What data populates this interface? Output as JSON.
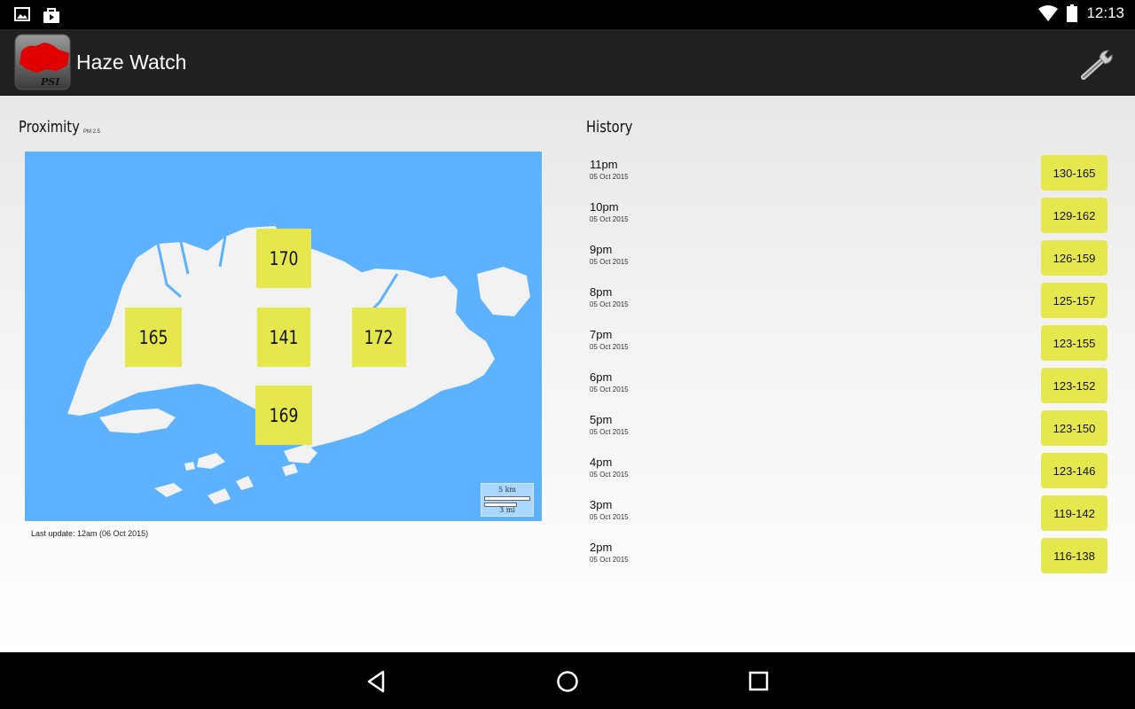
{
  "status_bar": {
    "time": "12:13",
    "left_icons": [
      "image-icon",
      "shopping-bag-icon"
    ],
    "right_icons": [
      "wifi-icon",
      "battery-icon"
    ]
  },
  "action_bar": {
    "title": "Haze Watch",
    "logo_text": "PSI",
    "settings_icon": "wrench-icon"
  },
  "proximity": {
    "title": "Proximity",
    "subtitle": "PM 2.5",
    "readings": {
      "north": "170",
      "west": "165",
      "central": "141",
      "east": "172",
      "south": "169"
    },
    "scale_km": "5 km",
    "scale_mi": "3 mi",
    "last_update": "Last update: 12am (06 Oct 2015)"
  },
  "history": {
    "title": "History",
    "items": [
      {
        "time": "11pm",
        "date": "05 Oct 2015",
        "range": "130-165"
      },
      {
        "time": "10pm",
        "date": "05 Oct 2015",
        "range": "129-162"
      },
      {
        "time": "9pm",
        "date": "05 Oct 2015",
        "range": "126-159"
      },
      {
        "time": "8pm",
        "date": "05 Oct 2015",
        "range": "125-157"
      },
      {
        "time": "7pm",
        "date": "05 Oct 2015",
        "range": "123-155"
      },
      {
        "time": "6pm",
        "date": "05 Oct 2015",
        "range": "123-152"
      },
      {
        "time": "5pm",
        "date": "05 Oct 2015",
        "range": "123-150"
      },
      {
        "time": "4pm",
        "date": "05 Oct 2015",
        "range": "123-146"
      },
      {
        "time": "3pm",
        "date": "05 Oct 2015",
        "range": "119-142"
      },
      {
        "time": "2pm",
        "date": "05 Oct 2015",
        "range": "116-138"
      }
    ]
  },
  "nav_bar": {
    "buttons": [
      "back-icon",
      "home-icon",
      "recents-icon"
    ]
  },
  "colors": {
    "sea": "#5cb2fe",
    "land": "#f2f2f2",
    "psi_box": "#e6e74c",
    "action_bar": "#212121"
  }
}
